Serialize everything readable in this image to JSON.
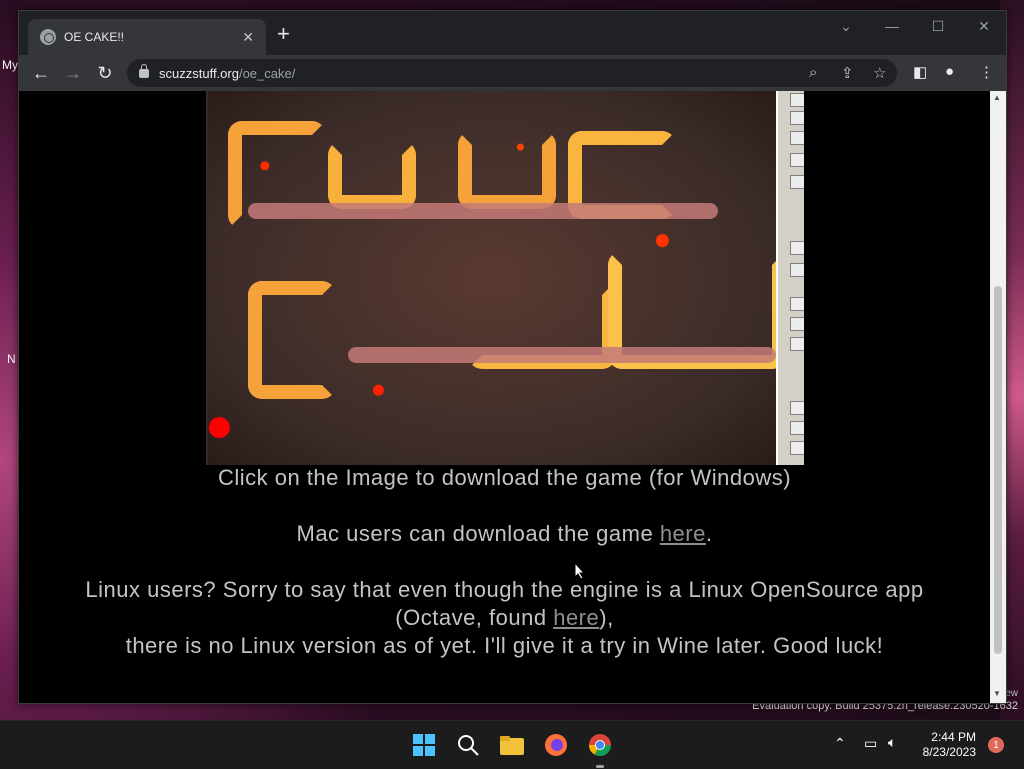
{
  "desktop": {
    "left_label_1": "My",
    "left_label_2": "N",
    "watermark_small": "ew",
    "watermark": "Evaluation copy. Build 25375.zn_release.230520-1632"
  },
  "browser": {
    "tab_title": "OE CAKE!!",
    "new_tab_label": "+",
    "url_host": "scuzzstuff.org",
    "url_path": "/oe_cake/"
  },
  "page": {
    "line1": "Click on the Image to download the game (for Windows)",
    "mac_prefix": "Mac users can download the game ",
    "mac_link": "here",
    "mac_suffix": ".",
    "linux_line1": "Linux users? Sorry to say that even though the engine is a Linux OpenSource app",
    "linux_line2_prefix": "(Octave, found ",
    "linux_link": "here",
    "linux_line2_suffix": "),",
    "linux_line3": "there is no Linux version as of yet. I'll give it a try in Wine later. Good luck!"
  },
  "taskbar": {
    "time": "2:44 PM",
    "date": "8/23/2023",
    "notification_count": "1"
  },
  "colors": {
    "page_bg": "#000000",
    "text": "#c4c4c4",
    "link": "#8f8f8f",
    "chrome_bg": "#202124",
    "toolbar_bg": "#35363a"
  }
}
